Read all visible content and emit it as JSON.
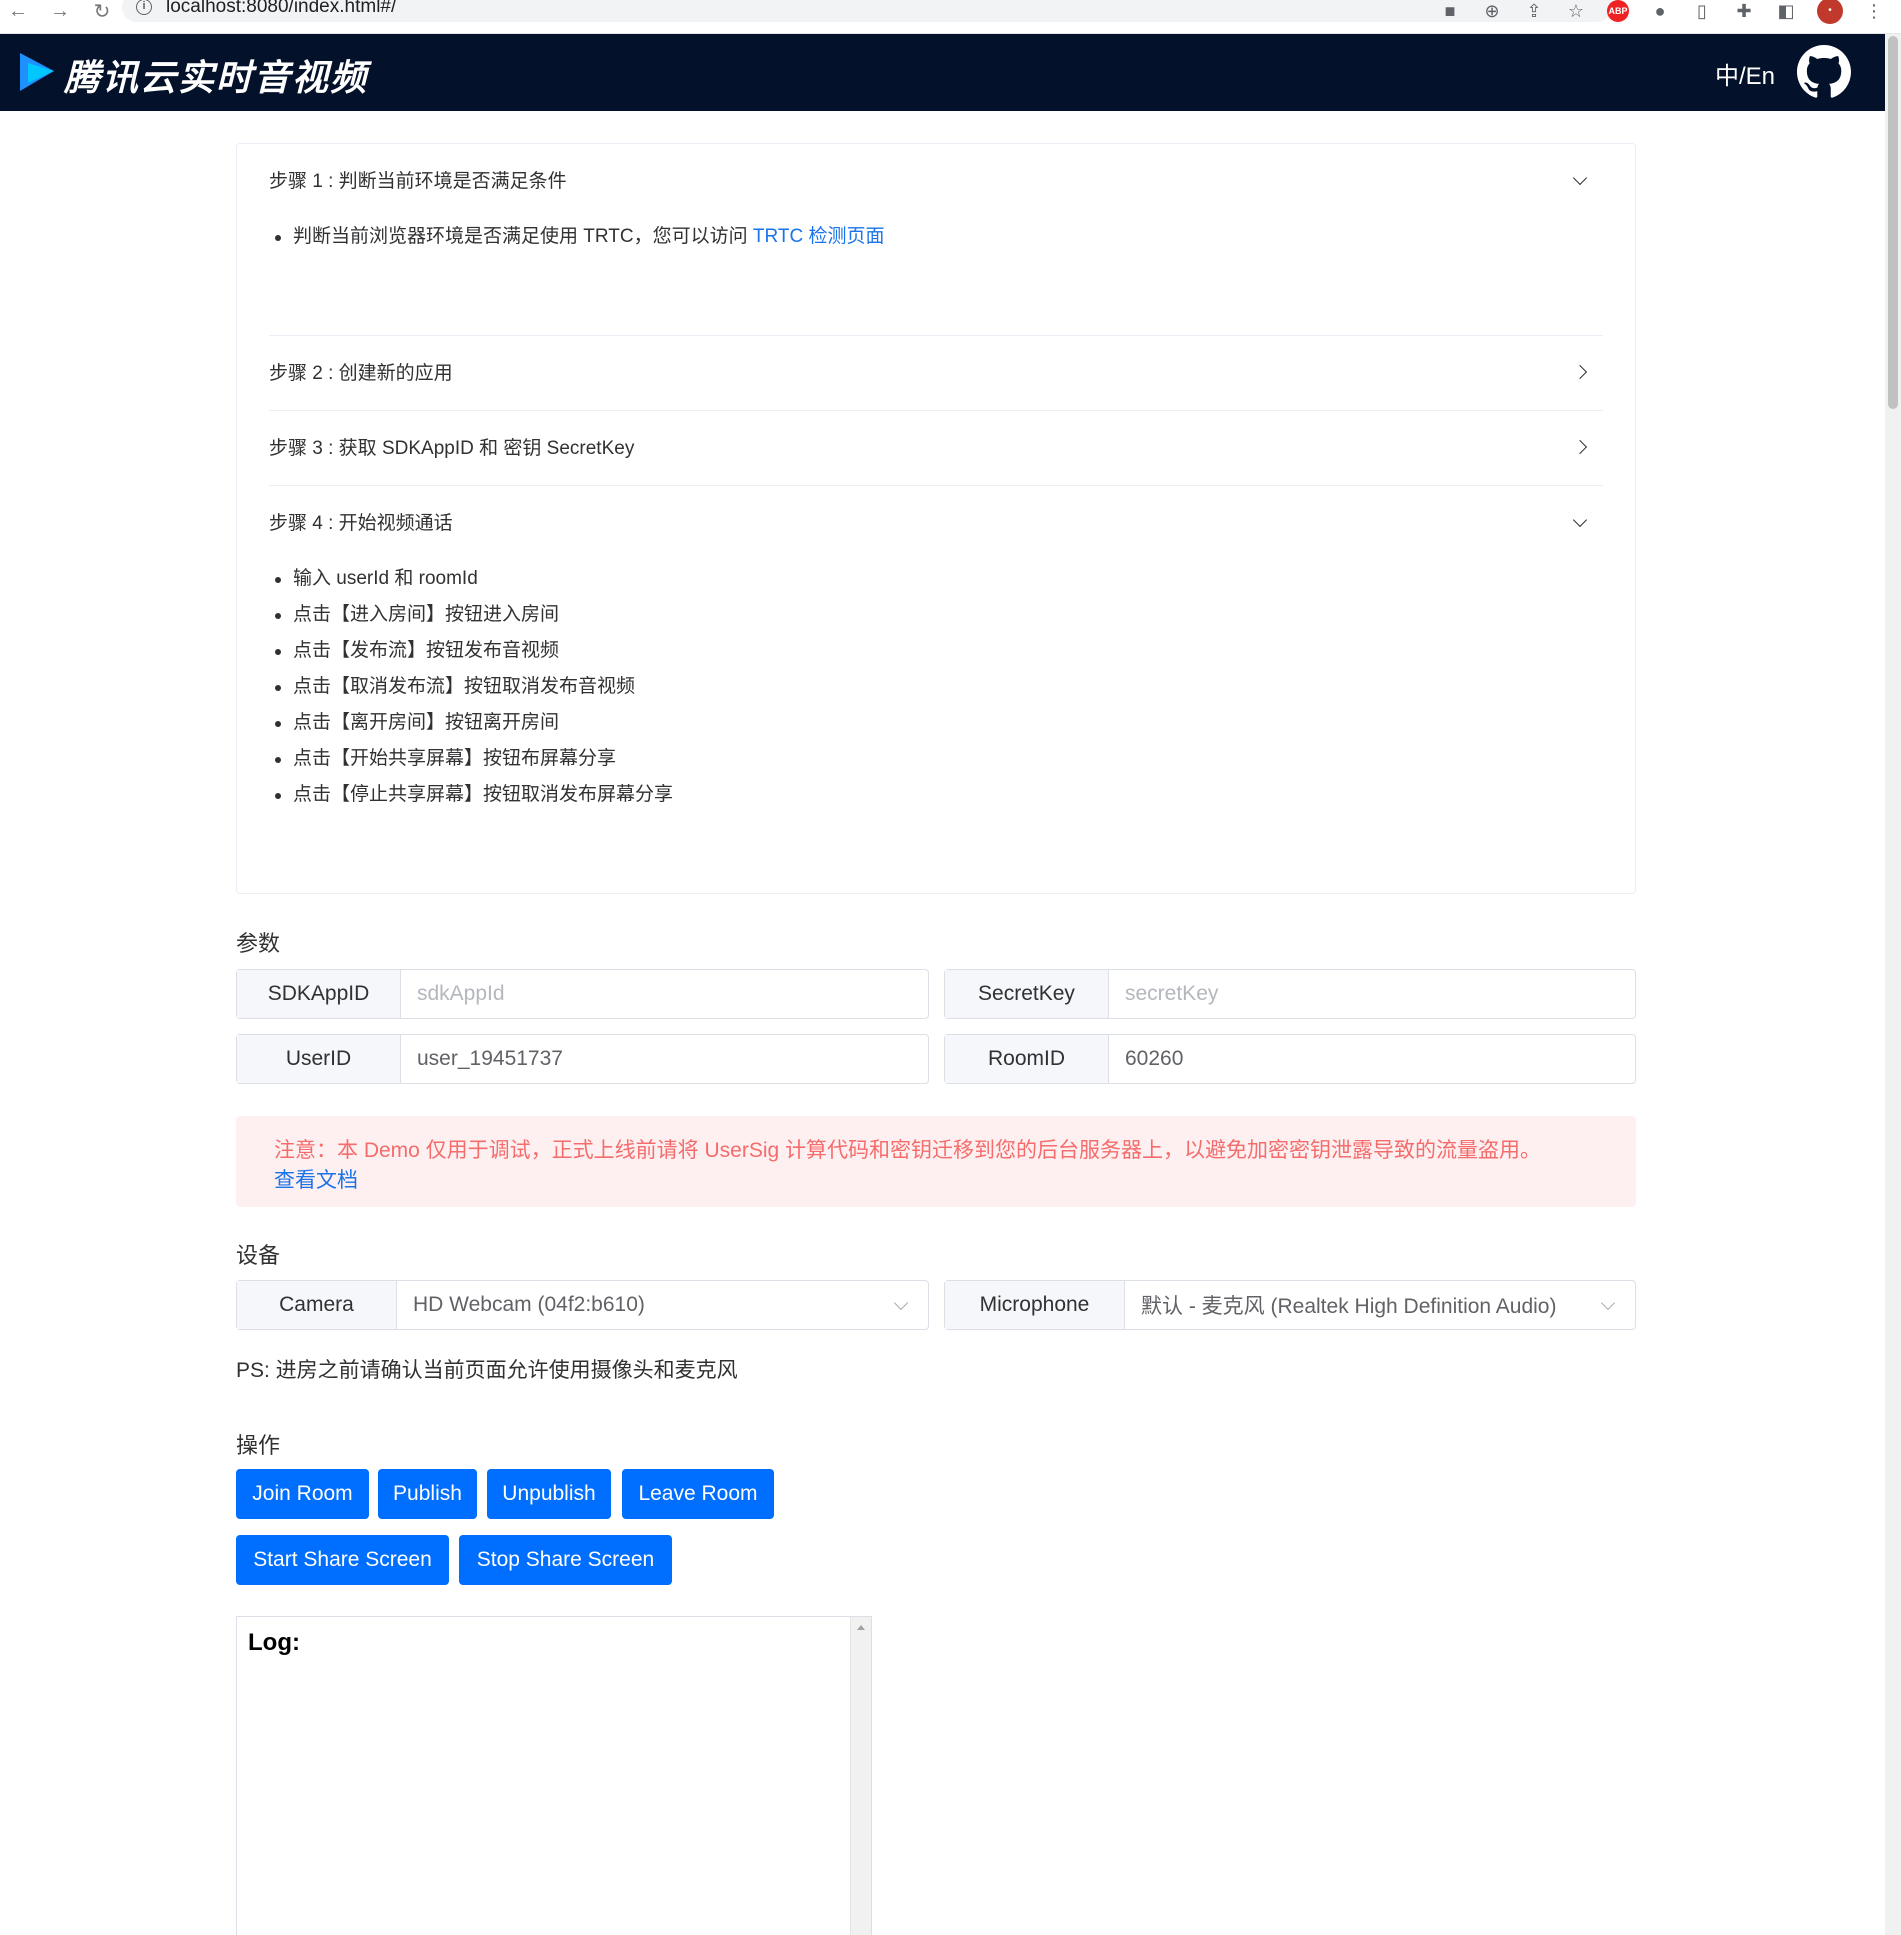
{
  "browser": {
    "url": "localhost:8080/index.html#/"
  },
  "header": {
    "brand": "腾讯云实时音视频",
    "lang_toggle": "中/En"
  },
  "steps": [
    {
      "title": "步骤 1 : 判断当前环境是否满足条件",
      "expanded": true,
      "items": [
        {
          "text": "判断当前浏览器环境是否满足使用 TRTC，您可以访问 ",
          "link": "TRTC 检测页面"
        }
      ]
    },
    {
      "title": "步骤 2 : 创建新的应用",
      "expanded": false
    },
    {
      "title": "步骤 3 : 获取 SDKAppID 和 密钥 SecretKey",
      "expanded": false
    },
    {
      "title": "步骤 4 : 开始视频通话",
      "expanded": true,
      "items": [
        "输入 userId 和 roomId",
        "点击【进入房间】按钮进入房间",
        "点击【发布流】按钮发布音视频",
        "点击【取消发布流】按钮取消发布音视频",
        "点击【离开房间】按钮离开房间",
        "点击【开始共享屏幕】按钮布屏幕分享",
        "点击【停止共享屏幕】按钮取消发布屏幕分享"
      ]
    }
  ],
  "params": {
    "title": "参数",
    "sdkappid": {
      "label": "SDKAppID",
      "value": "",
      "placeholder": "sdkAppId"
    },
    "secretkey": {
      "label": "SecretKey",
      "value": "",
      "placeholder": "secretKey"
    },
    "userid": {
      "label": "UserID",
      "value": "user_19451737"
    },
    "roomid": {
      "label": "RoomID",
      "value": "60260"
    }
  },
  "alert": {
    "text": "注意：本 Demo 仅用于调试，正式上线前请将 UserSig 计算代码和密钥迁移到您的后台服务器上，以避免加密密钥泄露导致的流量盗用。",
    "link": "查看文档"
  },
  "devices": {
    "title": "设备",
    "camera": {
      "label": "Camera",
      "selected": "HD Webcam (04f2:b610)"
    },
    "microphone": {
      "label": "Microphone",
      "selected": "默认 - 麦克风 (Realtek High Definition Audio)"
    },
    "note": "PS: 进房之前请确认当前页面允许使用摄像头和麦克风"
  },
  "actions": {
    "title": "操作",
    "join": "Join Room",
    "publish": "Publish",
    "unpublish": "Unpublish",
    "leave": "Leave Room",
    "start_share": "Start Share Screen",
    "stop_share": "Stop Share Screen"
  },
  "log": {
    "title": "Log:"
  },
  "colors": {
    "header_bg": "#04112a",
    "primary_button": "#006eff",
    "link": "#1a73e8",
    "alert_bg": "#fef0f0",
    "alert_text": "#f56c6c"
  },
  "icons": [
    "back-icon",
    "forward-icon",
    "reload-icon",
    "info-icon",
    "camera-icon",
    "zoom-icon",
    "share-icon",
    "star-icon",
    "adblock-icon",
    "extension-icon",
    "sidepanel-icon",
    "menu-icon",
    "github-icon",
    "tencent-logo-icon",
    "chevron-down-icon",
    "chevron-right-icon"
  ]
}
